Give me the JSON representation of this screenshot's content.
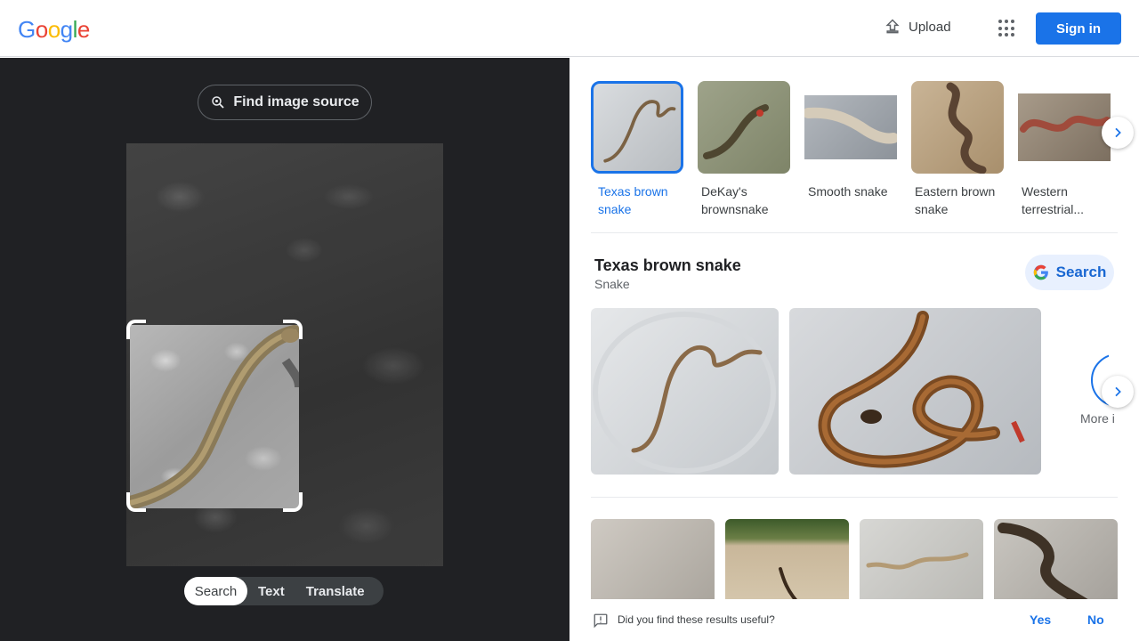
{
  "header": {
    "logo_letters": [
      "G",
      "o",
      "o",
      "g",
      "l",
      "e"
    ],
    "upload_label": "Upload",
    "signin_label": "Sign in"
  },
  "lens": {
    "find_source_label": "Find image source",
    "modes": [
      {
        "label": "Search",
        "active": true
      },
      {
        "label": "Text",
        "active": false
      },
      {
        "label": "Translate",
        "active": false
      }
    ]
  },
  "suggestions": [
    {
      "label": "Texas brown snake",
      "selected": true
    },
    {
      "label": "DeKay's brownsnake",
      "selected": false
    },
    {
      "label": "Smooth snake",
      "selected": false
    },
    {
      "label": "Eastern brown snake",
      "selected": false
    },
    {
      "label": "Western terrestrial...",
      "selected": false
    }
  ],
  "knowledge": {
    "title": "Texas brown snake",
    "subtitle": "Snake",
    "search_label": "Search",
    "more_label": "More i"
  },
  "feedback": {
    "question": "Did you find these results useful?",
    "yes_label": "Yes",
    "no_label": "No"
  },
  "colors": {
    "accent": "#1a73e8",
    "dark_panel": "#202124",
    "logo_blue": "#4285F4",
    "logo_red": "#EA4335",
    "logo_yellow": "#FBBC05",
    "logo_green": "#34A853"
  }
}
